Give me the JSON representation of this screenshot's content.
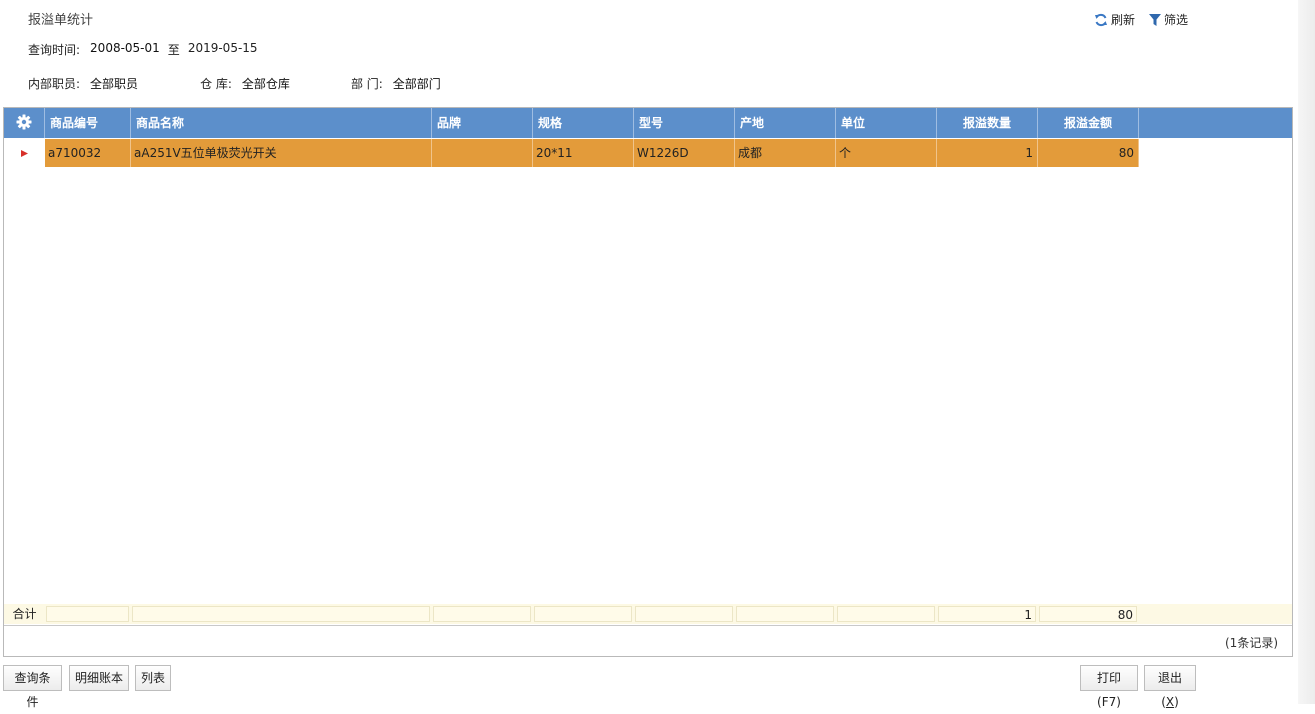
{
  "page": {
    "title": "报溢单统计"
  },
  "toolbar": {
    "refresh_label": "刷新",
    "filter_label": "筛选"
  },
  "query": {
    "time_label": "查询时间:",
    "start_date": "2008-05-01",
    "to_label": "至",
    "end_date": "2019-05-15",
    "staff_label": "内部职员:",
    "staff_value": "全部职员",
    "warehouse_label": "仓 库:",
    "warehouse_value": "全部仓库",
    "dept_label": "部 门:",
    "dept_value": "全部部门"
  },
  "table": {
    "headers": [
      "商品编号",
      "商品名称",
      "品牌",
      "规格",
      "型号",
      "产地",
      "单位",
      "报溢数量",
      "报溢金额"
    ],
    "rows": [
      {
        "code": "a710032",
        "name": "aA251V五位单极荧光开关",
        "brand": "",
        "spec": "20*11",
        "model": "W1226D",
        "origin": "成都",
        "unit": "个",
        "qty": "1",
        "amount": "80"
      }
    ],
    "totals": {
      "label": "合计",
      "qty": "1",
      "amount": "80"
    },
    "records_text": "(1条记录)"
  },
  "buttons": {
    "query_conditions": "查询条件",
    "detail_ledger": "明细账本",
    "list": "列表",
    "print": "打印(F7)",
    "exit_prefix": "退出(",
    "exit_key": "X",
    "exit_suffix": ")"
  },
  "colors": {
    "header_bg": "#5c8fcb",
    "selected_row": "#e39b3a",
    "totals_bg": "#fdf9e4",
    "marker": "#d8302a"
  }
}
